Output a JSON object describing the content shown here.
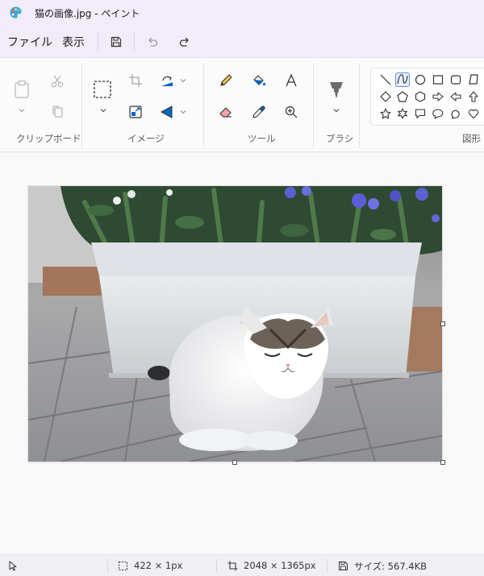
{
  "window": {
    "title": "猫の画像.jpg - ペイント"
  },
  "menu": {
    "file": "ファイル",
    "view": "表示"
  },
  "ribbon": {
    "groups": {
      "clipboard": "クリップボード",
      "image": "イメージ",
      "tools": "ツール",
      "brushes": "ブラシ",
      "shapes": "図形"
    }
  },
  "status": {
    "selection_size": "422 × 1px",
    "image_size": "2048 × 1365px",
    "file_size": "サイズ: 567.4KB"
  },
  "colors": {
    "accent": "#0067c0",
    "titlebar": "#f1ecf7"
  },
  "icons": {
    "app": "paint-app-icon",
    "save": "save-icon",
    "undo": "undo-icon",
    "redo": "redo-icon",
    "paste": "paste-icon",
    "cut": "cut-icon",
    "copy": "copy-icon",
    "select": "select-icon",
    "crop": "crop-icon",
    "resize": "resize-icon",
    "rotate": "rotate-icon",
    "flip": "flip-icon",
    "pencil": "pencil-icon",
    "fill": "fill-icon",
    "text": "text-icon",
    "eraser": "eraser-icon",
    "color_picker": "color-picker-icon",
    "magnifier": "magnifier-icon",
    "brush": "brush-icon",
    "cursor": "cursor-icon"
  }
}
